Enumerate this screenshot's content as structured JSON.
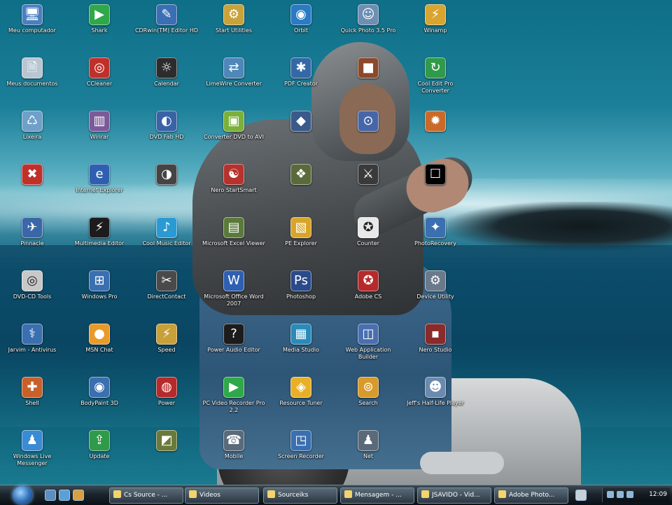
{
  "desktop": {
    "icons": [
      {
        "label": "Meu computador",
        "icon": "computer-icon",
        "color": "#4a7fc0",
        "glyph": "🖥"
      },
      {
        "label": "Shark",
        "icon": "play-arrow-icon",
        "color": "#2fa84a",
        "glyph": "▶"
      },
      {
        "label": "CDRwin(TM) Editor HD",
        "icon": "media-editor-icon",
        "color": "#3b6fb5",
        "glyph": "✎"
      },
      {
        "label": "Start Utilities",
        "icon": "utilities-icon",
        "color": "#c9a23b",
        "glyph": "⚙"
      },
      {
        "label": "Orbit",
        "icon": "orbit-icon",
        "color": "#2a7ac4",
        "glyph": "◉"
      },
      {
        "label": "Quick Photo 3.5 Pro",
        "icon": "photo-icon",
        "color": "#6d8fb3",
        "glyph": "☺"
      },
      {
        "label": "Winamp",
        "icon": "winamp-icon",
        "color": "#d9a531",
        "glyph": "⚡"
      },
      {
        "label": "Meus documentos",
        "icon": "documents-icon",
        "color": "#b8c6d2",
        "glyph": "🗎"
      },
      {
        "label": "CCleaner",
        "icon": "ccleaner-icon",
        "color": "#c0302b",
        "glyph": "◎"
      },
      {
        "label": "Calendar",
        "icon": "calendar-icon",
        "color": "#2c2c2c",
        "glyph": "☼"
      },
      {
        "label": "LimeWire Converter",
        "icon": "converter-icon",
        "color": "#4e87b9",
        "glyph": "⇄"
      },
      {
        "label": "PDF Creator",
        "icon": "pdf-icon",
        "color": "#3469a8",
        "glyph": "✱"
      },
      {
        "label": "",
        "icon": "app-icon",
        "color": "#8b4a2d",
        "glyph": "■"
      },
      {
        "label": "Cool Edit Pro Converter",
        "icon": "audio-converter-icon",
        "color": "#2f9a4a",
        "glyph": "↻"
      },
      {
        "label": "Lixeira",
        "icon": "recycle-bin-icon",
        "color": "#6fa0c8",
        "glyph": "♺"
      },
      {
        "label": "Winrar",
        "icon": "winrar-icon",
        "color": "#7b5a9a",
        "glyph": "▥"
      },
      {
        "label": "DVD Fab HD",
        "icon": "dvd-icon",
        "color": "#3a63a6",
        "glyph": "◐"
      },
      {
        "label": "Converter DVD to AVI",
        "icon": "video-converter-icon",
        "color": "#7bb03a",
        "glyph": "▣"
      },
      {
        "label": "",
        "icon": "app-icon",
        "color": "#3a5a8a",
        "glyph": "◆"
      },
      {
        "label": "",
        "icon": "search-icon",
        "color": "#4766a8",
        "glyph": "⊙"
      },
      {
        "label": "",
        "icon": "paint-icon",
        "color": "#c96a2a",
        "glyph": "✹"
      },
      {
        "label": "",
        "icon": "network-icon",
        "color": "#c0302b",
        "glyph": "✖"
      },
      {
        "label": "Internet Explorer",
        "icon": "globe-icon",
        "color": "#2f5fb0",
        "glyph": "e"
      },
      {
        "label": "",
        "icon": "app-icon",
        "color": "#444444",
        "glyph": "◑"
      },
      {
        "label": "Nero StartSmart",
        "icon": "nero-icon",
        "color": "#b5322d",
        "glyph": "☯"
      },
      {
        "label": "",
        "icon": "app-icon",
        "color": "#5a6a3a",
        "glyph": "❖"
      },
      {
        "label": "",
        "icon": "app-icon",
        "color": "#3a3a3a",
        "glyph": "⚔"
      },
      {
        "label": "",
        "icon": "app-icon",
        "color": "#000000",
        "glyph": "☐"
      },
      {
        "label": "Pinnacle",
        "icon": "pinnacle-icon",
        "color": "#3a67a8",
        "glyph": "✈"
      },
      {
        "label": "Multimedia Editor",
        "icon": "multimedia-icon",
        "color": "#1c1c1c",
        "glyph": "⚡"
      },
      {
        "label": "Cool Music Editor",
        "icon": "music-editor-icon",
        "color": "#2a9ad4",
        "glyph": "♪"
      },
      {
        "label": "Microsoft Excel Viewer",
        "icon": "excel-icon",
        "color": "#5a7a3a",
        "glyph": "▤"
      },
      {
        "label": "PE Explorer",
        "icon": "pe-explorer-icon",
        "color": "#d8a52a",
        "glyph": "▧"
      },
      {
        "label": "Counter",
        "icon": "counter-strike-icon",
        "color": "#e8e8e8",
        "glyph": "✪"
      },
      {
        "label": "PhotoRecovery",
        "icon": "recovery-icon",
        "color": "#3a6fb0",
        "glyph": "✦"
      },
      {
        "label": "DVD-CD Tools",
        "icon": "disc-icon",
        "color": "#c8c8c8",
        "glyph": "◎"
      },
      {
        "label": "Windows Pro",
        "icon": "windows-icon",
        "color": "#3a6fb0",
        "glyph": "⊞"
      },
      {
        "label": "DirectContact",
        "icon": "scissors-icon",
        "color": "#4a4a4a",
        "glyph": "✂"
      },
      {
        "label": "Microsoft Office Word 2007",
        "icon": "word-icon",
        "color": "#2f5fb0",
        "glyph": "W"
      },
      {
        "label": "Photoshop",
        "icon": "photoshop-icon",
        "color": "#2a4a8a",
        "glyph": "Ps"
      },
      {
        "label": "Adobe CS",
        "icon": "adobe-icon",
        "color": "#b52a2a",
        "glyph": "✪"
      },
      {
        "label": "Device Utility",
        "icon": "device-icon",
        "color": "#6a7a8a",
        "glyph": "⚙"
      },
      {
        "label": "Jarvim - Antivirus",
        "icon": "antivirus-icon",
        "color": "#3a6fb0",
        "glyph": "⚕"
      },
      {
        "label": "MSN Chat",
        "icon": "msn-icon",
        "color": "#e89a2a",
        "glyph": "●"
      },
      {
        "label": "Speed",
        "icon": "speed-icon",
        "color": "#c8a03a",
        "glyph": "⚡"
      },
      {
        "label": "Power Audio Editor",
        "icon": "help-icon",
        "color": "#1c1c1c",
        "glyph": "?"
      },
      {
        "label": "Media Studio",
        "icon": "media-studio-icon",
        "color": "#2a8ab8",
        "glyph": "▦"
      },
      {
        "label": "Web Application Builder",
        "icon": "web-builder-icon",
        "color": "#4a6fb0",
        "glyph": "◫"
      },
      {
        "label": "Nero Studio",
        "icon": "nero-studio-icon",
        "color": "#8a2a2a",
        "glyph": "▪"
      },
      {
        "label": "Shell",
        "icon": "shell-icon",
        "color": "#c8602a",
        "glyph": "✚"
      },
      {
        "label": "BodyPaint 3D",
        "icon": "bodypaint-icon",
        "color": "#3a6fb0",
        "glyph": "◉"
      },
      {
        "label": "Power",
        "icon": "power-icon",
        "color": "#b52a2a",
        "glyph": "◍"
      },
      {
        "label": "PC Video Recorder Pro 2.2",
        "icon": "video-recorder-icon",
        "color": "#2fa84a",
        "glyph": "▶"
      },
      {
        "label": "Resource Tuner",
        "icon": "resource-icon",
        "color": "#e8b02a",
        "glyph": "◈"
      },
      {
        "label": "Search",
        "icon": "search-icon",
        "color": "#d89a2a",
        "glyph": "⊚"
      },
      {
        "label": "Jeff's Half-Life Player",
        "icon": "player-icon",
        "color": "#6a8ab0",
        "glyph": "☻"
      },
      {
        "label": "Windows Live Messenger",
        "icon": "messenger-icon",
        "color": "#3a8ad4",
        "glyph": "♟"
      },
      {
        "label": "Update",
        "icon": "update-icon",
        "color": "#2f9a4a",
        "glyph": "⇪"
      },
      {
        "label": "",
        "icon": "app-icon",
        "color": "#6a7a3a",
        "glyph": "◩"
      },
      {
        "label": "Mobile",
        "icon": "mobile-icon",
        "color": "#5a6a7a",
        "glyph": "☎"
      },
      {
        "label": "Screen Recorder",
        "icon": "screen-recorder-icon",
        "color": "#3a6fb0",
        "glyph": "◳"
      },
      {
        "label": "Net",
        "icon": "net-icon",
        "color": "#5a6a7a",
        "glyph": "♟"
      }
    ]
  },
  "taskbar": {
    "buttons": [
      {
        "label": "Cs Source - ...",
        "icon": "folder-icon"
      },
      {
        "label": "Videos",
        "icon": "folder-icon"
      },
      {
        "label": "Sourceiks",
        "icon": "folder-icon"
      },
      {
        "label": "Mensagem - ...",
        "icon": "mail-icon"
      },
      {
        "label": "JSAVIDO - Vid...",
        "icon": "video-icon"
      },
      {
        "label": "Adobe Photo...",
        "icon": "photoshop-icon"
      }
    ],
    "clock": "12:09"
  }
}
